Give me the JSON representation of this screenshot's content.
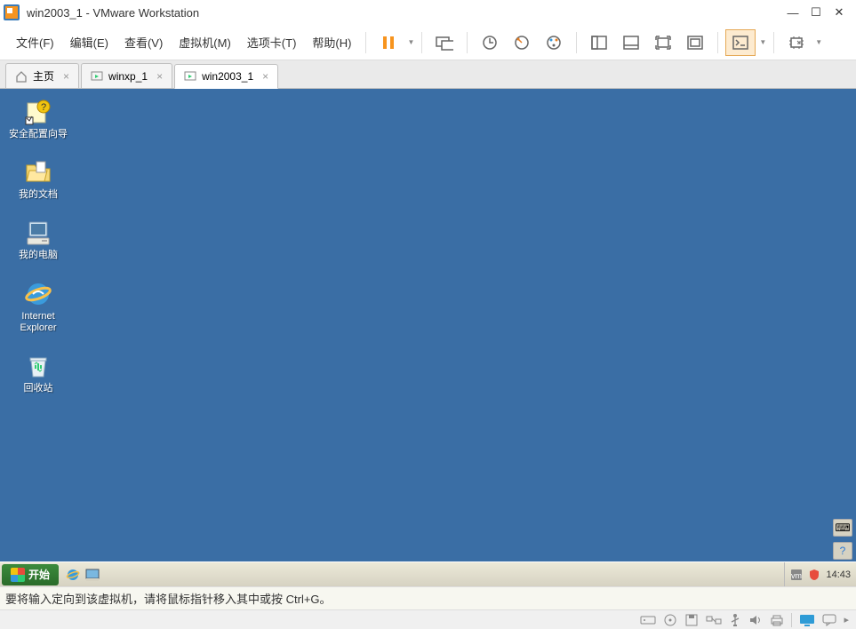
{
  "window": {
    "title": "win2003_1 - VMware Workstation"
  },
  "menu": {
    "file": "文件(F)",
    "edit": "编辑(E)",
    "view": "查看(V)",
    "vm": "虚拟机(M)",
    "tabs": "选项卡(T)",
    "help": "帮助(H)"
  },
  "tabs": {
    "home": "主页",
    "winxp": "winxp_1",
    "win2003": "win2003_1"
  },
  "desktop": {
    "security_wizard": "安全配置向导",
    "my_documents": "我的文档",
    "my_computer": "我的电脑",
    "ie": "Internet Explorer",
    "recycle_bin": "回收站"
  },
  "taskbar": {
    "start": "开始",
    "clock": "14:43"
  },
  "hint": "要将输入定向到该虚拟机，请将鼠标指针移入其中或按 Ctrl+G。"
}
